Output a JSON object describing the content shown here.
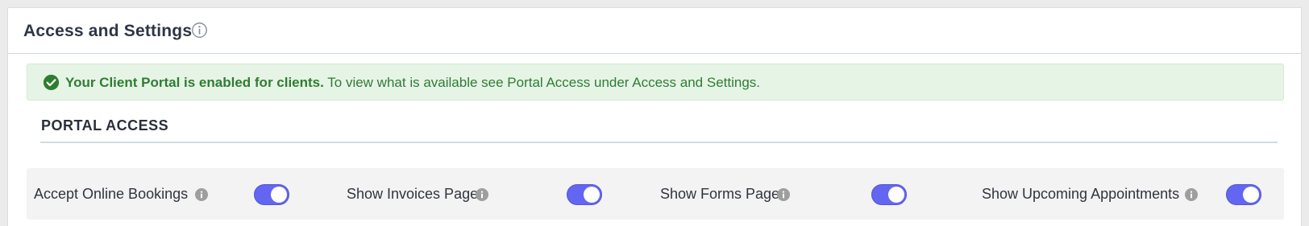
{
  "header": {
    "title": "Access and Settings",
    "info_icon": "info-outline-icon"
  },
  "alert": {
    "icon": "check-circle-icon",
    "strong_text": "Your Client Portal is enabled for clients.",
    "text": " To view what is available see Portal Access under Access and Settings.",
    "color": "#2e7d32",
    "background": "#e6f4e6"
  },
  "section": {
    "title": "PORTAL ACCESS"
  },
  "settings": [
    {
      "label": "Accept Online Bookings",
      "enabled": true
    },
    {
      "label": "Show Invoices Page",
      "enabled": true
    },
    {
      "label": "Show Forms Page",
      "enabled": true
    },
    {
      "label": "Show Upcoming Appointments",
      "enabled": true
    }
  ],
  "colors": {
    "toggle_on": "#6366f1",
    "info_icon": "#9e9e9e"
  }
}
